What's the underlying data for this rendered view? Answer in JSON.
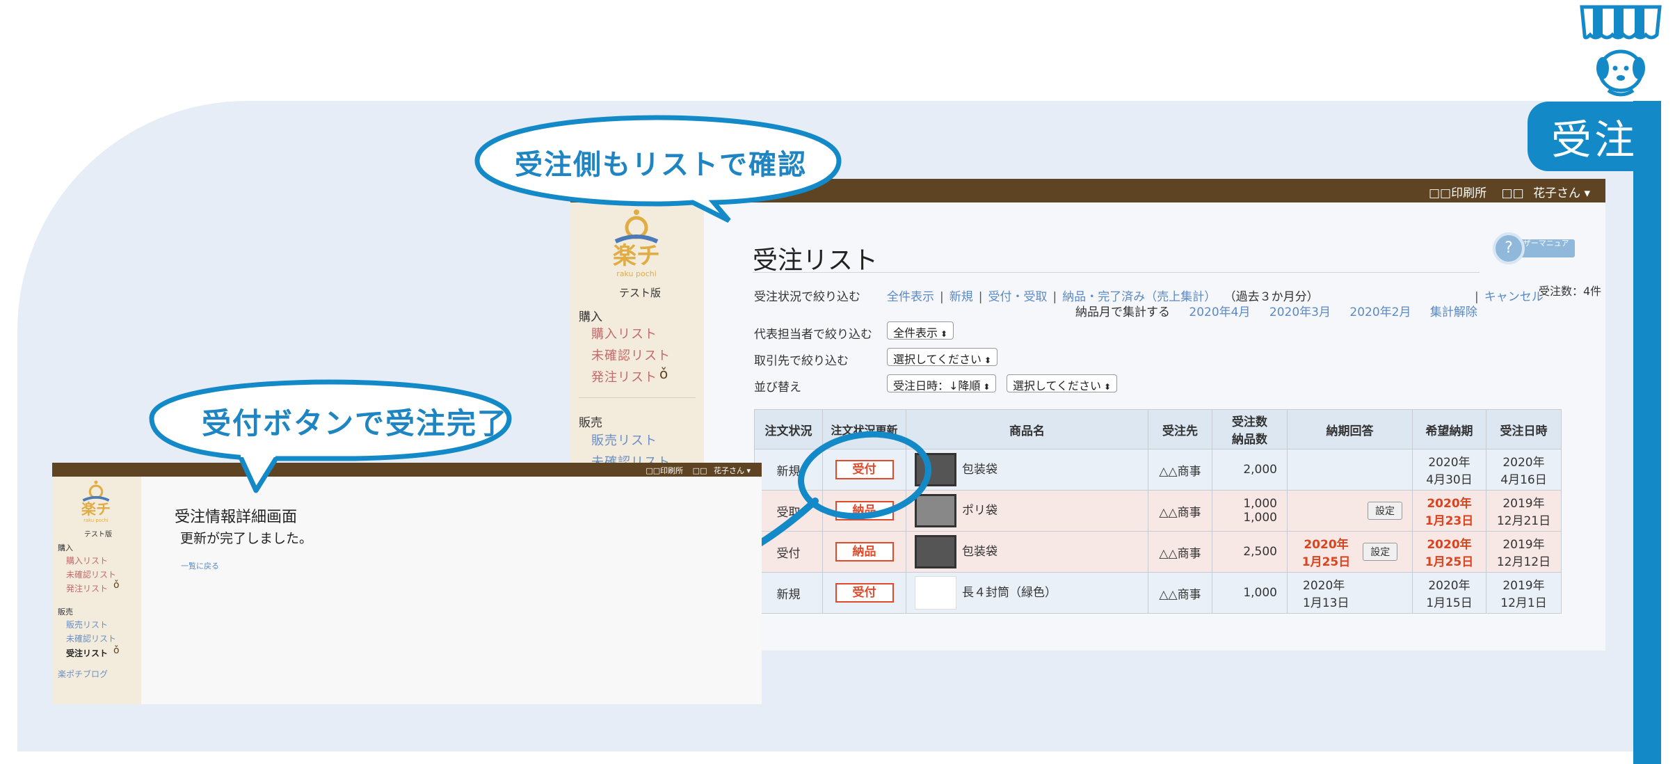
{
  "tab": {
    "label": "受注"
  },
  "bubbles": {
    "top": "受注側もリストで確認",
    "left": "受付ボタンで受注完了"
  },
  "app": {
    "company": "□□印刷所",
    "user_prefix": "□□",
    "user_name": "花子さん ▾",
    "logo_sub": "raku pochi",
    "logo_kana": "楽チ",
    "edition": "テスト版"
  },
  "sidebar": {
    "buy_heading": "購入",
    "buy_items": [
      "購入リスト",
      "未確認リスト",
      "発注リスト"
    ],
    "sell_heading": "販売",
    "sell_items": [
      "販売リスト",
      "未確認リスト",
      "受注リスト"
    ],
    "blog": "楽ポチブログ"
  },
  "main": {
    "title": "受注リスト",
    "manual_label": "ユーザーマニュアル",
    "count": "受注数：4件",
    "filter_status_label": "受注状況で絞り込む",
    "filter_links": [
      "全件表示",
      "新規",
      "受付・受取",
      "納品・完了済み（売上集計）"
    ],
    "filter_note": "（過去３か月分）",
    "cancel_link": "キャンセル",
    "monthly_label": "納品月で集計する",
    "month_links": [
      "2020年4月",
      "2020年3月",
      "2020年2月",
      "集計解除"
    ],
    "rep_label": "代表担当者で絞り込む",
    "rep_value": "全件表示",
    "client_label": "取引先で絞り込む",
    "client_value": "選択してください",
    "sort_label": "並び替え",
    "sort_value": "受注日時：↓降順",
    "sort_value2": "選択してください"
  },
  "table": {
    "headers": [
      "注文状況",
      "注文状況更新",
      "商品名",
      "受注先",
      "受注数\n納品数",
      "納期回答",
      "希望納期",
      "受注日時"
    ],
    "rows": [
      {
        "status": "新規",
        "button": "受付",
        "product": "包装袋",
        "client": "△△商事",
        "qty": "2,000",
        "qty2": "",
        "answer": "",
        "has_set": false,
        "wish": "2020年\n4月30日",
        "wish_red": false,
        "date": "2020年\n4月16日"
      },
      {
        "status": "受取",
        "button": "納品",
        "product": "ポリ袋",
        "client": "△△商事",
        "qty": "1,000",
        "qty2": "1,000",
        "answer": "",
        "has_set": true,
        "wish": "2020年\n1月23日",
        "wish_red": true,
        "date": "2019年\n12月21日"
      },
      {
        "status": "受付",
        "button": "納品",
        "product": "包装袋",
        "client": "△△商事",
        "qty": "2,500",
        "qty2": "",
        "answer": "2020年\n1月25日",
        "answer_red": true,
        "has_set": true,
        "wish": "2020年\n1月25日",
        "wish_red": true,
        "date": "2019年\n12月12日"
      },
      {
        "status": "新規",
        "button": "受付",
        "product": "長４封筒（緑色）",
        "client": "△△商事",
        "qty": "1,000",
        "qty2": "",
        "answer": "2020年\n1月13日",
        "answer_red": false,
        "has_set": false,
        "wish": "2020年\n1月15日",
        "wish_red": false,
        "date": "2019年\n12月1日"
      }
    ],
    "set_label": "設定"
  },
  "detail": {
    "title": "受注情報詳細画面",
    "message": "更新が完了しました。",
    "back_link": "一覧に戻る"
  },
  "colors": {
    "accent": "#1389c8",
    "topbar": "#5e4423",
    "sidebar": "#f3ecdd",
    "status_red": "#e04a2b"
  }
}
